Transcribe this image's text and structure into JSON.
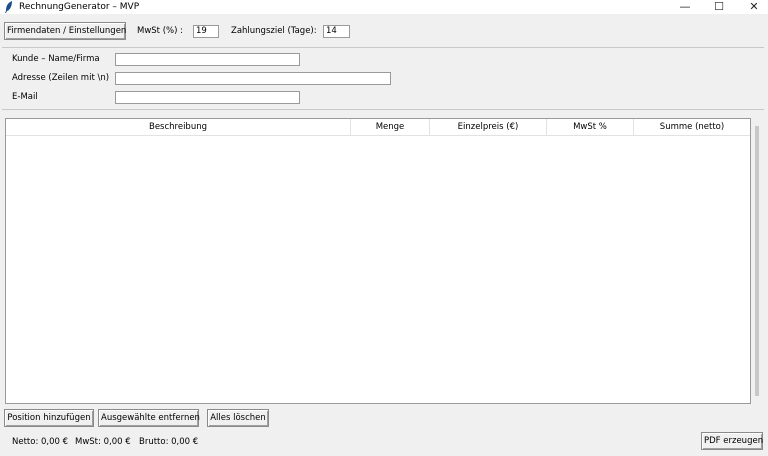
{
  "window": {
    "title": "RechnungGenerator – MVP",
    "minimize_glyph": "—",
    "maximize_glyph": "☐",
    "close_glyph": "✕"
  },
  "toolbar": {
    "settings_button": "Firmendaten / Einstellungen",
    "vat_label": "MwSt (%) :",
    "vat_value": "19",
    "due_label": "Zahlungsziel (Tage):",
    "due_value": "14"
  },
  "customer": {
    "name_label": "Kunde – Name/Firma",
    "name_value": "",
    "address_label": "Adresse (Zeilen mit \\n)",
    "address_value": "",
    "email_label": "E-Mail",
    "email_value": ""
  },
  "table": {
    "columns": [
      "Beschreibung",
      "Menge",
      "Einzelpreis (€)",
      "MwSt %",
      "Summe (netto)"
    ],
    "rows": []
  },
  "actions": {
    "add_position": "Position hinzufügen",
    "remove_selected": "Ausgewählte entfernen",
    "clear_all": "Alles löschen",
    "create_pdf": "PDF erzeugen"
  },
  "totals": {
    "net": "Netto: 0,00 €",
    "vat": "MwSt: 0,00 €",
    "gross": "Brutto: 0,00 €"
  }
}
